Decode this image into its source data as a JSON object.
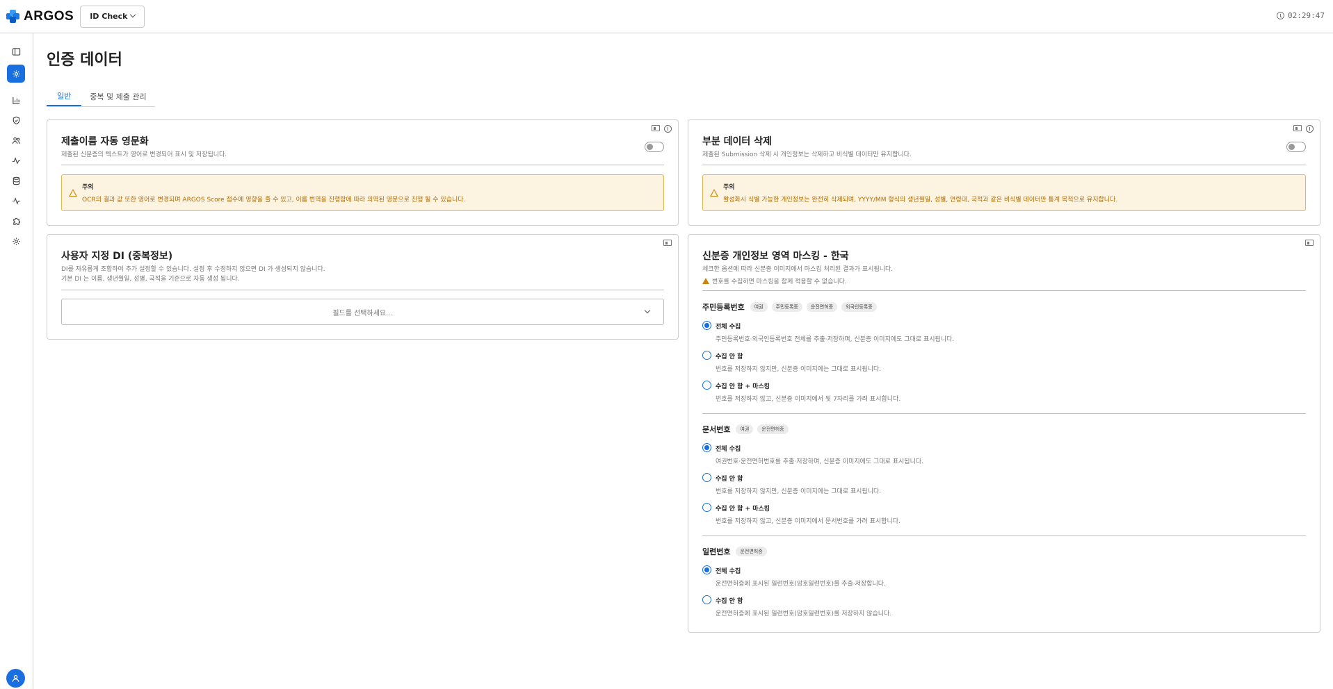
{
  "topbar": {
    "brand": "ARGOS",
    "product": "ID Check",
    "time": "02:29:47"
  },
  "colors": {
    "accent": "#1a6fe0",
    "warning": "#c8860e",
    "warning_bg": "#fdf3e1"
  },
  "sidebar": {
    "items": [
      {
        "icon": "panel-toggle-icon"
      },
      {
        "icon": "settings-icon",
        "active": true
      },
      {
        "icon": "bar-chart-icon"
      },
      {
        "icon": "shield-check-icon"
      },
      {
        "icon": "users-icon"
      },
      {
        "icon": "activity-icon"
      },
      {
        "icon": "database-icon"
      },
      {
        "icon": "pulse-icon"
      },
      {
        "icon": "puzzle-icon"
      },
      {
        "icon": "gear-icon"
      }
    ]
  },
  "page": {
    "title": "인증 데이터",
    "tabs": [
      {
        "label": "일반",
        "active": true
      },
      {
        "label": "중복 및 제출 관리",
        "active": false
      }
    ]
  },
  "card_translit": {
    "title": "제출이름 자동 영문화",
    "desc": "제출된 신분증의 텍스트가 영어로 변경되어 표시 및 저장됩니다.",
    "warn_title": "주의",
    "warn_text": "OCR의 결과 값 또한 영어로 변경되며 ARGOS Score 점수에 영향을 줄 수 있고, 이름 번역을 진행함에 따라 의역된 영문으로 진행 될 수 있습니다."
  },
  "card_partial": {
    "title": "부분 데이터 삭제",
    "desc": "제출된 Submission 삭제 시 개인정보는 삭제하고 비식별 데이터만 유지합니다.",
    "warn_title": "주의",
    "warn_text": "활성화시 식별 가능한 개인정보는 완전히 삭제되며, YYYY/MM 형식의 생년월일, 성별, 연령대, 국적과 같은 비식별 데이터만 통계 목적으로 유지합니다."
  },
  "card_di": {
    "title": "사용자 지정 DI (중복정보)",
    "desc1": "DI를 자유롭게 조합하여 추가 설정할 수 있습니다. 설정 후 수정하지 않으면 DI 가 생성되지 않습니다.",
    "desc2": "기본 DI 는 이름, 생년월일, 성별, 국적을 기준으로 자동 생성 됩니다.",
    "select_placeholder": "필드를 선택하세요..."
  },
  "card_mask": {
    "title": "신분증 개인정보 영역 마스킹 - 한국",
    "desc": "체크한 옵션에 따라 신분증 이미지에서 마스킹 처리된 결과가 표시됩니다.",
    "warn": "번호를 수집하면 마스킹을 함께 적용할 수 없습니다.",
    "sections": [
      {
        "name": "주민등록번호",
        "chips": [
          "여권",
          "주민등록증",
          "운전면허증",
          "외국인등록증"
        ],
        "options": [
          {
            "label": "전체 수집",
            "desc": "주민등록번호·외국인등록번호 전체를 추출·저장하며, 신분증 이미지에도 그대로 표시됩니다.",
            "checked": true
          },
          {
            "label": "수집 안 함",
            "desc": "번호를 저장하지 않지만, 신분증 이미지에는 그대로 표시됩니다.",
            "checked": false
          },
          {
            "label": "수집 안 함 + 마스킹",
            "desc": "번호를 저장하지 않고, 신분증 이미지에서 뒷 7자리를 가려 표시합니다.",
            "checked": false
          }
        ]
      },
      {
        "name": "문서번호",
        "chips": [
          "여권",
          "운전면허증"
        ],
        "options": [
          {
            "label": "전체 수집",
            "desc": "여권번호·운전면허번호를 추출·저장하며, 신분증 이미지에도 그대로 표시됩니다.",
            "checked": true
          },
          {
            "label": "수집 안 함",
            "desc": "번호를 저장하지 않지만, 신분증 이미지에는 그대로 표시됩니다.",
            "checked": false
          },
          {
            "label": "수집 안 함 + 마스킹",
            "desc": "번호를 저장하지 않고, 신분증 이미지에서 문서번호를 가려 표시합니다.",
            "checked": false
          }
        ]
      },
      {
        "name": "일련번호",
        "chips": [
          "운전면허증"
        ],
        "options": [
          {
            "label": "전체 수집",
            "desc": "운전면허증에 표시된 일련번호(암호일련번호)를 추출·저장합니다.",
            "checked": true
          },
          {
            "label": "수집 안 함",
            "desc": "운전면허증에 표시된 일련번호(암호일련번호)를 저장하지 않습니다.",
            "checked": false
          }
        ]
      }
    ]
  }
}
